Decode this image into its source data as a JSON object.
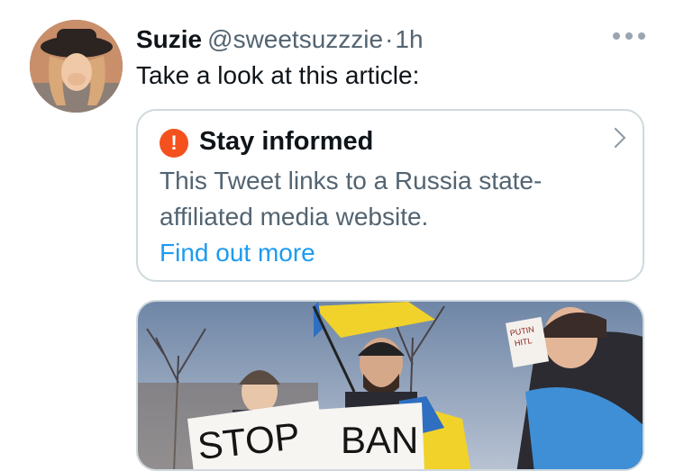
{
  "tweet": {
    "author_name": "Suzie",
    "handle": "@sweetsuzzzie",
    "separator": "·",
    "time": "1h",
    "text": "Take a look at this article:"
  },
  "notice": {
    "icon": "exclamation-circle-icon",
    "icon_glyph": "!",
    "title": "Stay informed",
    "body": "This Tweet links to a Russia state-affiliated media website.",
    "link": "Find out more"
  },
  "media": {
    "sign_stop": "STOP",
    "sign_ban": "BAN",
    "sign_putin_line1": "PUTIN",
    "sign_putin_line2": "HITL"
  },
  "colors": {
    "accent": "#1d9bf0",
    "warning": "#f4511e",
    "secondary_text": "#536471",
    "border": "#cfd9de"
  }
}
